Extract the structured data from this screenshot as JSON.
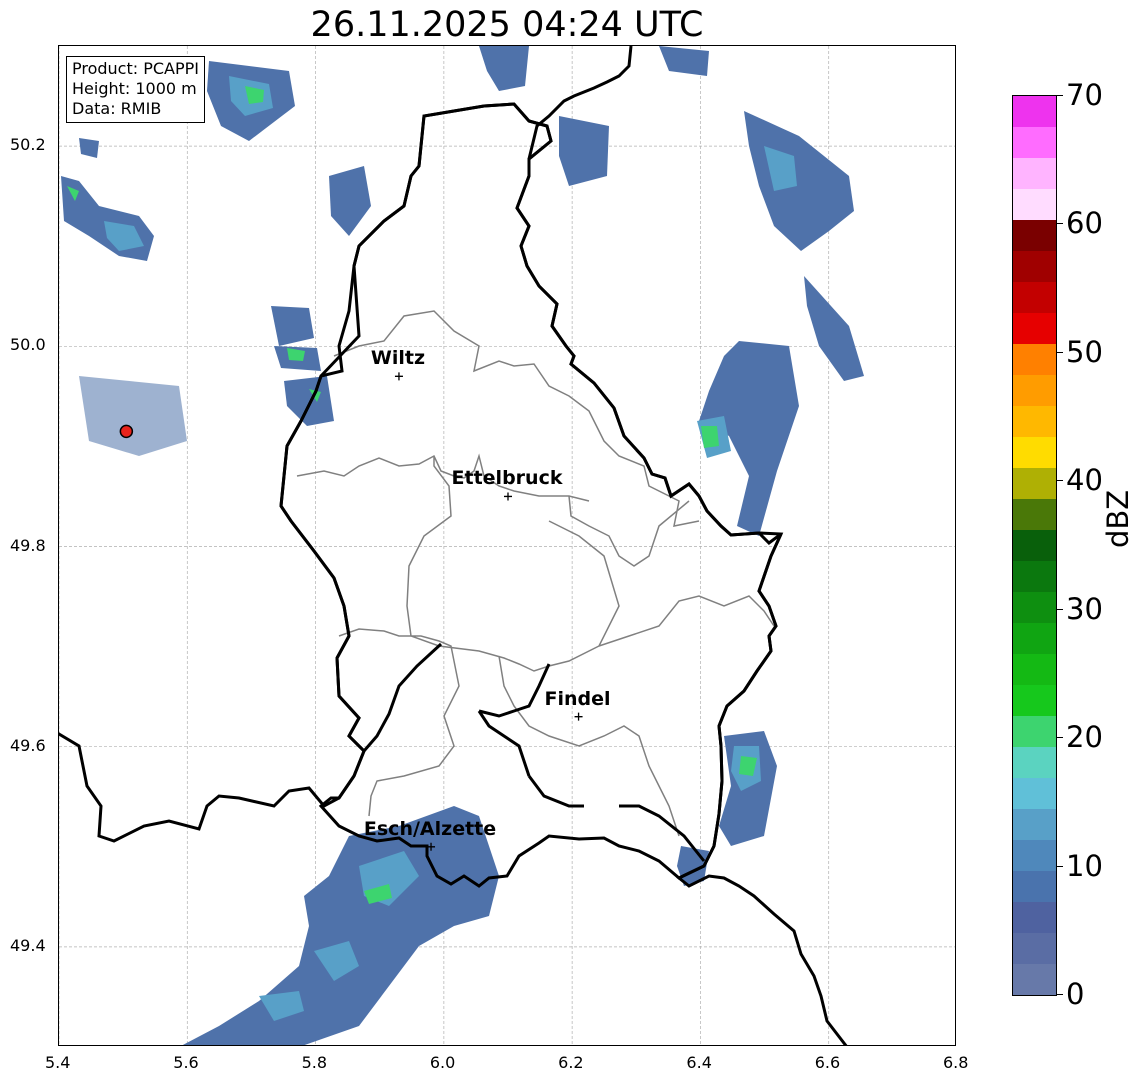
{
  "title": "26.11.2025 04:24 UTC",
  "info_box": {
    "product": "Product: PCAPPI",
    "height": "Height: 1000 m",
    "data": "Data: RMIB"
  },
  "map": {
    "lon_range": [
      5.4,
      6.8
    ],
    "lat_range": [
      49.3,
      50.3
    ],
    "x_ticks": [
      "5.4",
      "5.6",
      "5.8",
      "6.0",
      "6.2",
      "6.4",
      "6.6",
      "6.8"
    ],
    "y_ticks": [
      "50.2",
      "50.0",
      "49.8",
      "49.6",
      "49.4"
    ],
    "grid": true,
    "cities": [
      {
        "name": "Wiltz",
        "lon": 5.93,
        "lat": 49.97
      },
      {
        "name": "Ettelbruck",
        "lon": 6.1,
        "lat": 49.85
      },
      {
        "name": "Findel",
        "lon": 6.21,
        "lat": 49.63
      },
      {
        "name": "Esch/Alzette",
        "lon": 5.98,
        "lat": 49.5
      }
    ],
    "radar_site": {
      "lon": 5.505,
      "lat": 49.915,
      "color": "#e8231b"
    }
  },
  "colorbar": {
    "label": "dBZ",
    "tick_labels": [
      "0",
      "10",
      "20",
      "30",
      "40",
      "50",
      "60",
      "70"
    ],
    "colors": [
      "#6779a9",
      "#5a6da4",
      "#4f62a0",
      "#4a73ad",
      "#4f88bb",
      "#58a0c8",
      "#60c0d8",
      "#5bd3c0",
      "#3dd46f",
      "#16c81c",
      "#14b914",
      "#10a512",
      "#0e8f10",
      "#0b780e",
      "#09600b",
      "#4a7808",
      "#afb004",
      "#ffdc00",
      "#ffb800",
      "#ff9c00",
      "#ff8000",
      "#e60000",
      "#c30000",
      "#a00000",
      "#7a0000",
      "#ffdcff",
      "#ffb4ff",
      "#ff6cff",
      "#ee33ee"
    ]
  }
}
